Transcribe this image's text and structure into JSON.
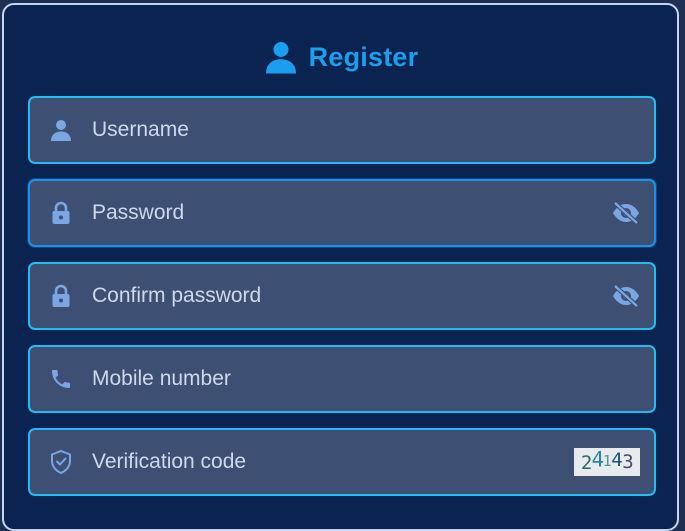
{
  "form": {
    "title": "Register",
    "icon": "user-icon",
    "accent_color": "#1a9ff0",
    "border_color": "#21bdf2"
  },
  "fields": {
    "username": {
      "placeholder": "Username",
      "icon": "user-icon"
    },
    "password": {
      "placeholder": "Password",
      "icon": "lock-icon",
      "toggle_icon": "eye-off-icon"
    },
    "confirm_password": {
      "placeholder": "Confirm password",
      "icon": "lock-icon",
      "toggle_icon": "eye-off-icon"
    },
    "mobile": {
      "placeholder": "Mobile number",
      "icon": "phone-icon"
    },
    "verification": {
      "placeholder": "Verification code",
      "icon": "shield-check-icon"
    }
  },
  "captcha": {
    "chars": [
      "2",
      "4",
      "1",
      "4",
      "3"
    ]
  }
}
